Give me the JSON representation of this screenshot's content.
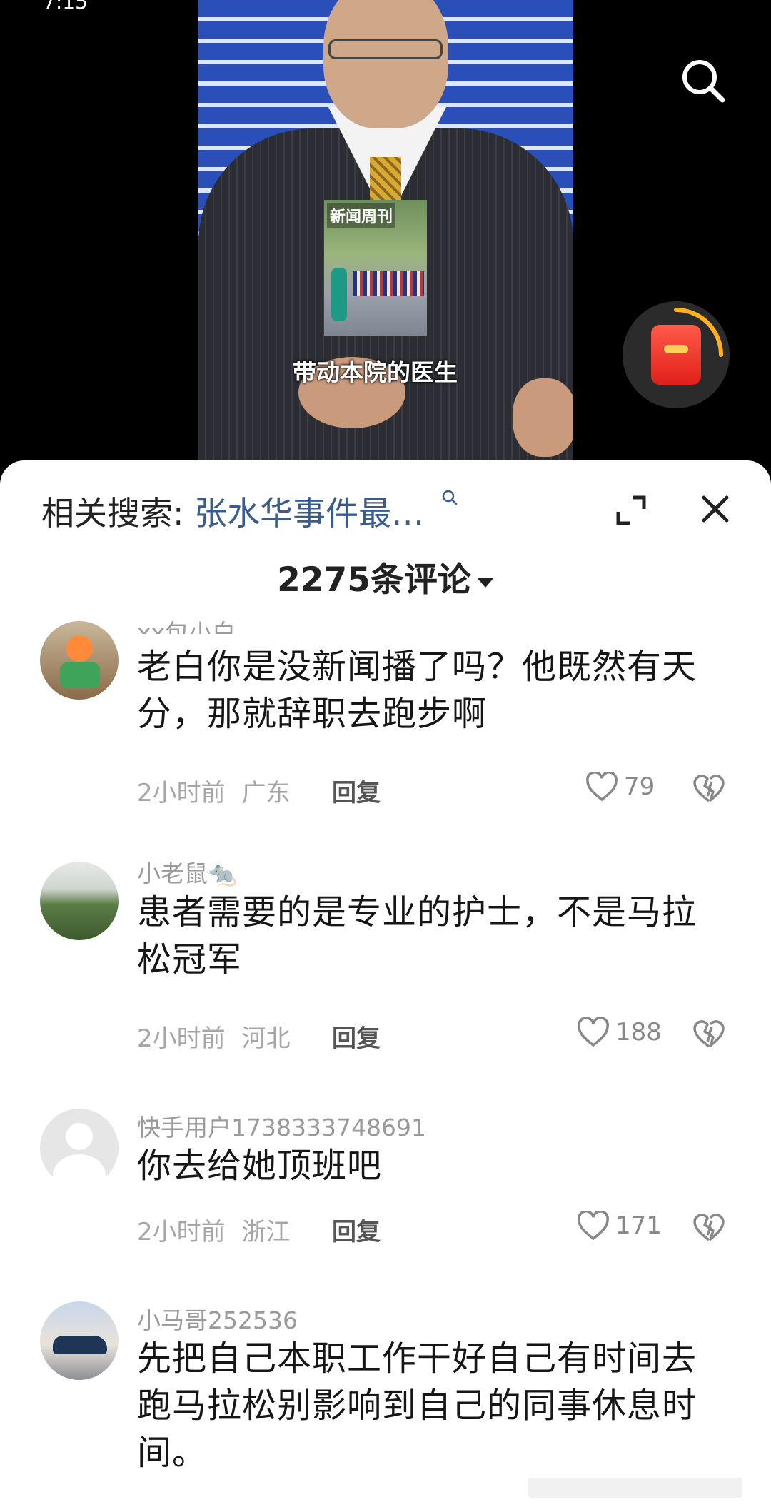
{
  "status_bar": {
    "time": "7:15"
  },
  "video": {
    "caption": "带动本院的医生",
    "inset_brand": "新闻周刊"
  },
  "sheet": {
    "related_label": "相关搜索:",
    "related_query": "张水华事件最…",
    "comment_count": "2275条评论"
  },
  "comments": [
    {
      "username": "xx包小白",
      "text": "老白你是没新闻播了吗？他既然有天分，那就辞职去跑步啊",
      "time": "2小时前",
      "region": "广东",
      "reply_label": "回复",
      "likes": "79"
    },
    {
      "username": "小老鼠🐀",
      "text": "患者需要的是专业的护士，不是马拉松冠军",
      "time": "2小时前",
      "region": "河北",
      "reply_label": "回复",
      "likes": "188"
    },
    {
      "username": "快手用户1738333748691",
      "text": "你去给她顶班吧",
      "time": "2小时前",
      "region": "浙江",
      "reply_label": "回复",
      "likes": "171"
    },
    {
      "username": "小马哥252536",
      "text": "先把自己本职工作干好自己有时间去跑马拉松别影响到自己的同事休息时间。",
      "time": "",
      "region": "",
      "reply_label": "",
      "likes": ""
    }
  ],
  "icons": {
    "search": "search-icon",
    "red_packet": "red-packet-icon",
    "expand": "expand-icon",
    "close": "close-icon",
    "like": "heart-icon",
    "dislike": "broken-heart-icon"
  },
  "colors": {
    "query_link": "#3a5c8c",
    "sheet_bg": "#ffffff",
    "meta": "#a6a6a6"
  }
}
